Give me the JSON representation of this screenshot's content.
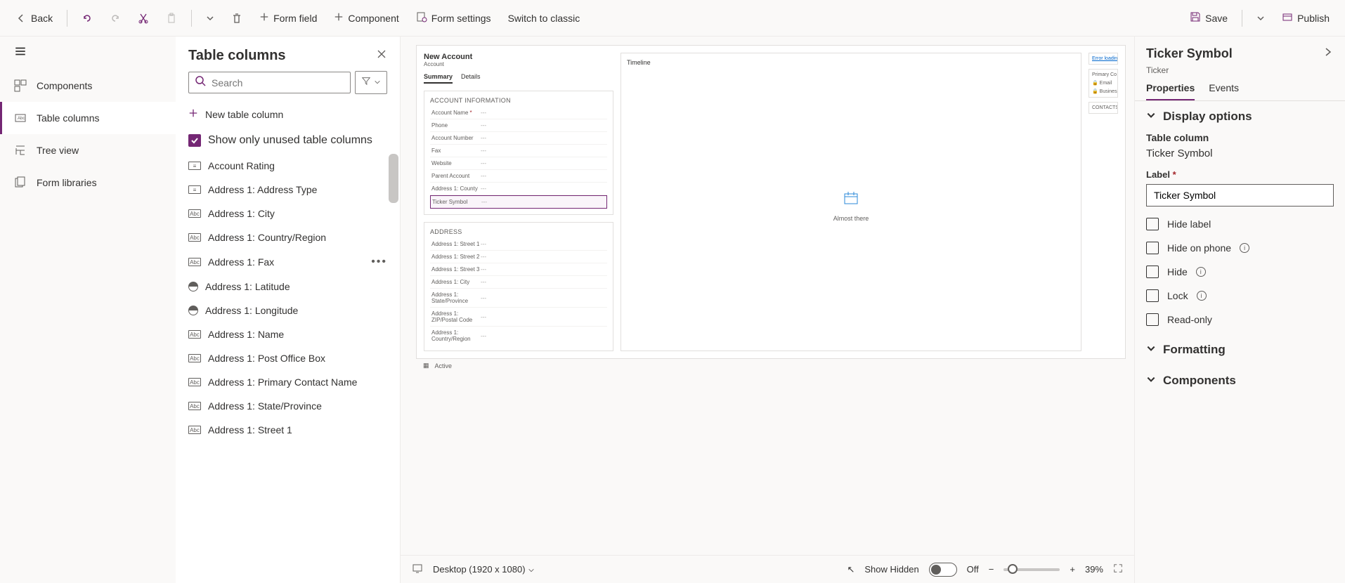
{
  "toolbar": {
    "back": "Back",
    "formField": "Form field",
    "component": "Component",
    "formSettings": "Form settings",
    "switchClassic": "Switch to classic",
    "save": "Save",
    "publish": "Publish"
  },
  "sidebar": {
    "items": [
      {
        "label": "Components"
      },
      {
        "label": "Table columns"
      },
      {
        "label": "Tree view"
      },
      {
        "label": "Form libraries"
      }
    ]
  },
  "tableColumns": {
    "title": "Table columns",
    "searchPlaceholder": "Search",
    "newColumn": "New table column",
    "showUnused": "Show only unused table columns",
    "items": [
      {
        "label": "Account Rating",
        "type": "opt"
      },
      {
        "label": "Address 1: Address Type",
        "type": "opt"
      },
      {
        "label": "Address 1: City",
        "type": "abc"
      },
      {
        "label": "Address 1: Country/Region",
        "type": "abc"
      },
      {
        "label": "Address 1: Fax",
        "type": "abc",
        "more": true
      },
      {
        "label": "Address 1: Latitude",
        "type": "globe"
      },
      {
        "label": "Address 1: Longitude",
        "type": "globe"
      },
      {
        "label": "Address 1: Name",
        "type": "abc"
      },
      {
        "label": "Address 1: Post Office Box",
        "type": "abc"
      },
      {
        "label": "Address 1: Primary Contact Name",
        "type": "abc"
      },
      {
        "label": "Address 1: State/Province",
        "type": "abc"
      },
      {
        "label": "Address 1: Street 1",
        "type": "abc"
      }
    ]
  },
  "form": {
    "title": "New Account",
    "subtitle": "Account",
    "tabs": [
      "Summary",
      "Details"
    ],
    "section1": {
      "title": "ACCOUNT INFORMATION",
      "fields": [
        {
          "label": "Account Name",
          "required": true
        },
        {
          "label": "Phone"
        },
        {
          "label": "Account Number"
        },
        {
          "label": "Fax"
        },
        {
          "label": "Website"
        },
        {
          "label": "Parent Account"
        },
        {
          "label": "Address 1: County"
        },
        {
          "label": "Ticker Symbol",
          "selected": true
        }
      ]
    },
    "section2": {
      "title": "ADDRESS",
      "fields": [
        {
          "label": "Address 1: Street 1"
        },
        {
          "label": "Address 1: Street 2"
        },
        {
          "label": "Address 1: Street 3"
        },
        {
          "label": "Address 1: City"
        },
        {
          "label": "Address 1: State/Province"
        },
        {
          "label": "Address 1: ZIP/Postal Code"
        },
        {
          "label": "Address 1: Country/Region"
        }
      ]
    },
    "timeline": {
      "title": "Timeline",
      "status": "Almost there"
    },
    "rightCards": {
      "error": "Error loading",
      "primary": "Primary Co",
      "email": "Email",
      "business": "Business",
      "contacts": "CONTACTS"
    },
    "statusBar": "Active"
  },
  "canvasFooter": {
    "viewport": "Desktop (1920 x 1080)",
    "showHidden": "Show Hidden",
    "toggleLabel": "Off",
    "zoom": "39%"
  },
  "properties": {
    "title": "Ticker Symbol",
    "subtitle": "Ticker",
    "tabs": [
      "Properties",
      "Events"
    ],
    "sections": {
      "displayOptions": "Display options",
      "formatting": "Formatting",
      "components": "Components"
    },
    "tableColumnLabel": "Table column",
    "tableColumnValue": "Ticker Symbol",
    "labelLabel": "Label",
    "labelValue": "Ticker Symbol",
    "checks": {
      "hideLabel": "Hide label",
      "hideOnPhone": "Hide on phone",
      "hide": "Hide",
      "lock": "Lock",
      "readOnly": "Read-only"
    }
  }
}
